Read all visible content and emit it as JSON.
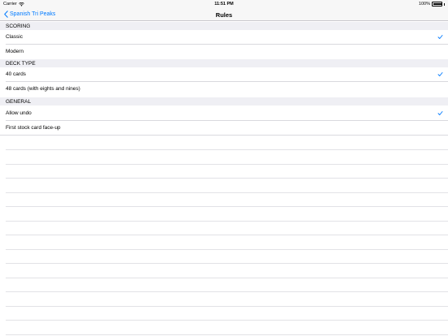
{
  "status_bar": {
    "carrier": "Carrier",
    "time": "11:51 PM",
    "battery_percent": "100%",
    "battery_level": 1.0
  },
  "nav": {
    "back_label": "Spanish Tri Peaks",
    "title": "Rules"
  },
  "sections": [
    {
      "header": "SCORING",
      "rows": [
        {
          "label": "Classic",
          "checked": true
        },
        {
          "label": "Modern",
          "checked": false
        }
      ]
    },
    {
      "header": "DECK TYPE",
      "rows": [
        {
          "label": "40 cards",
          "checked": true
        },
        {
          "label": "48 cards (with eights and nines)",
          "checked": false
        }
      ]
    },
    {
      "header": "GENERAL",
      "rows": [
        {
          "label": "Allow undo",
          "checked": true
        },
        {
          "label": "First stock card face-up",
          "checked": false
        }
      ]
    }
  ],
  "colors": {
    "accent": "#007aff",
    "section_bg": "#efeff4",
    "bar_bg": "#f7f7f7"
  },
  "icons": {
    "back": "chevron-left-icon",
    "check": "checkmark-icon",
    "wifi": "wifi-icon",
    "battery": "battery-icon"
  }
}
